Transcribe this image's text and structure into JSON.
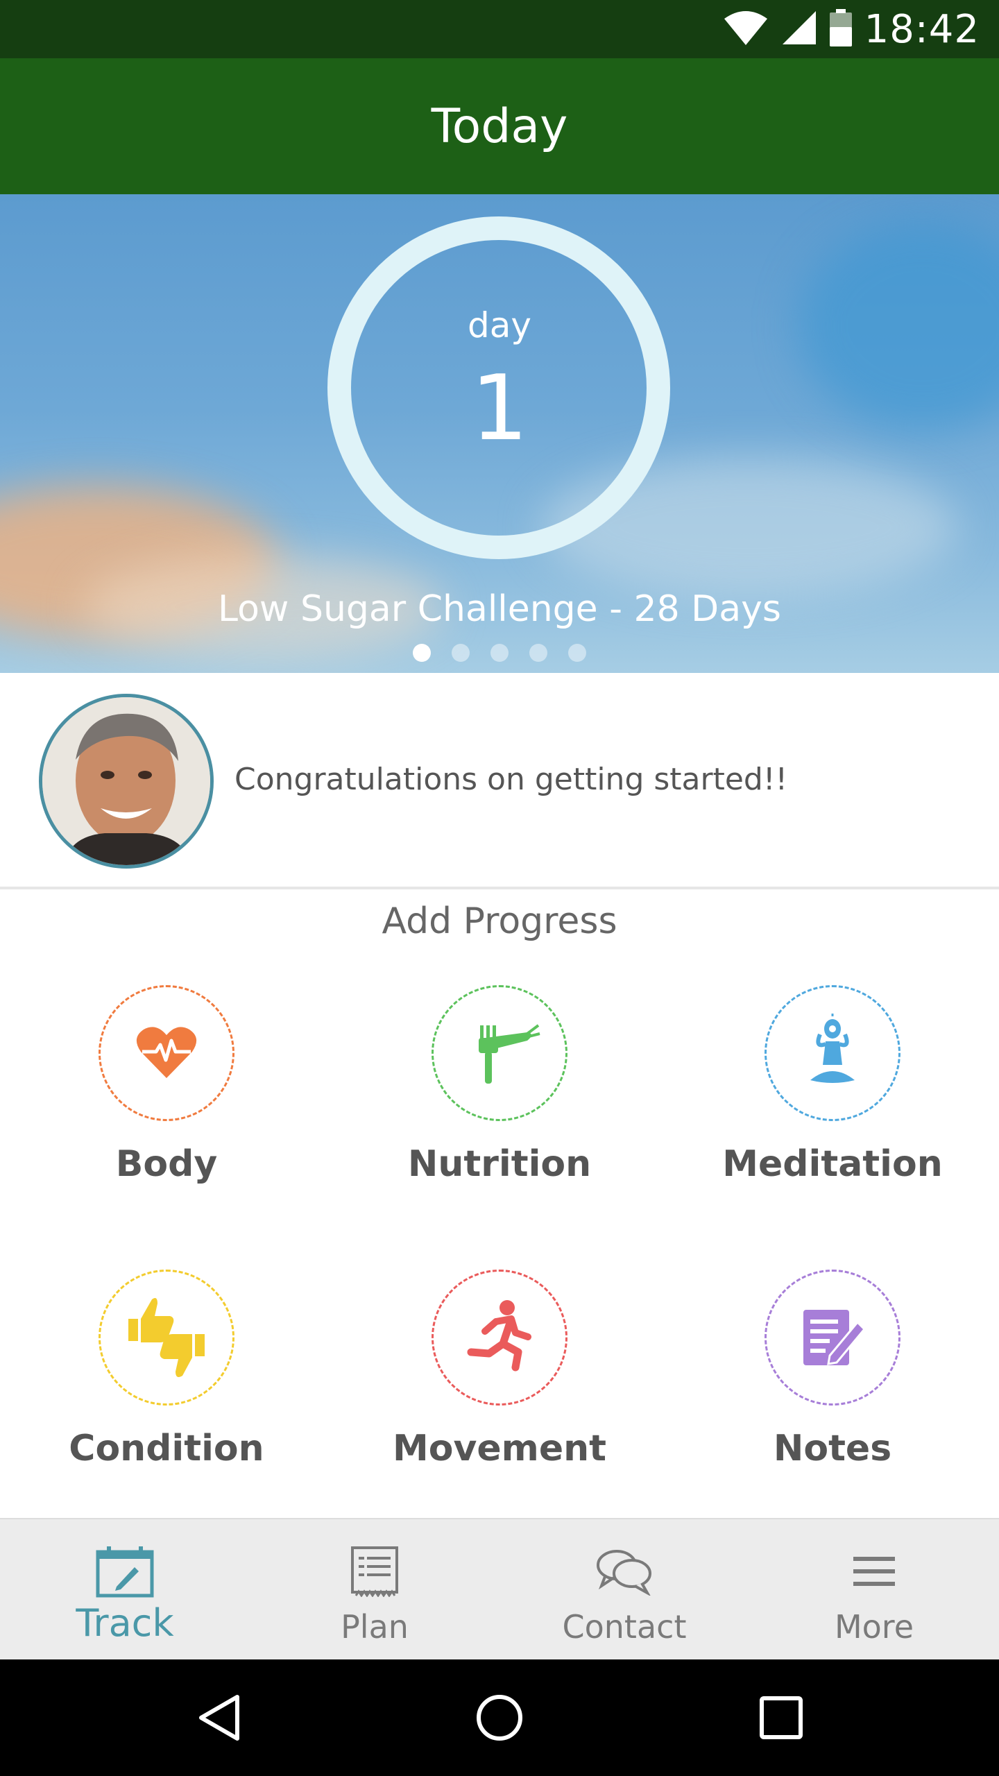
{
  "status_bar": {
    "time": "18:42",
    "icons": [
      "wifi-icon",
      "signal-icon",
      "battery-icon"
    ],
    "background": "#153e11"
  },
  "app_bar": {
    "title": "Today",
    "background": "#1d6016"
  },
  "hero": {
    "day_label": "day",
    "day_number": "1",
    "challenge_title": "Low Sugar Challenge - 28 Days",
    "page_count": 5,
    "active_page": 1
  },
  "coach": {
    "message": "Congratulations on getting started!!",
    "avatar_icon": "coach-avatar"
  },
  "progress": {
    "title": "Add Progress",
    "items": [
      {
        "label": "Body",
        "icon": "heart-rate-icon",
        "color": "#f07b3f"
      },
      {
        "label": "Nutrition",
        "icon": "carrot-fork-icon",
        "color": "#5cc25c"
      },
      {
        "label": "Meditation",
        "icon": "meditation-icon",
        "color": "#4fa8de"
      },
      {
        "label": "Condition",
        "icon": "thumbs-up-down-icon",
        "color": "#f3cc2e"
      },
      {
        "label": "Movement",
        "icon": "running-icon",
        "color": "#ea5b5b"
      },
      {
        "label": "Notes",
        "icon": "notes-icon",
        "color": "#a77ed8"
      }
    ]
  },
  "bottom_nav": {
    "items": [
      {
        "label": "Track",
        "icon": "calendar-edit-icon",
        "active": true
      },
      {
        "label": "Plan",
        "icon": "list-icon",
        "active": false
      },
      {
        "label": "Contact",
        "icon": "chat-bubbles-icon",
        "active": false
      },
      {
        "label": "More",
        "icon": "menu-icon",
        "active": false
      }
    ],
    "active_color": "#4a98a8",
    "inactive_color": "#7a7a7a"
  },
  "system_nav": {
    "buttons": [
      "back-icon",
      "home-icon",
      "recents-icon"
    ]
  }
}
